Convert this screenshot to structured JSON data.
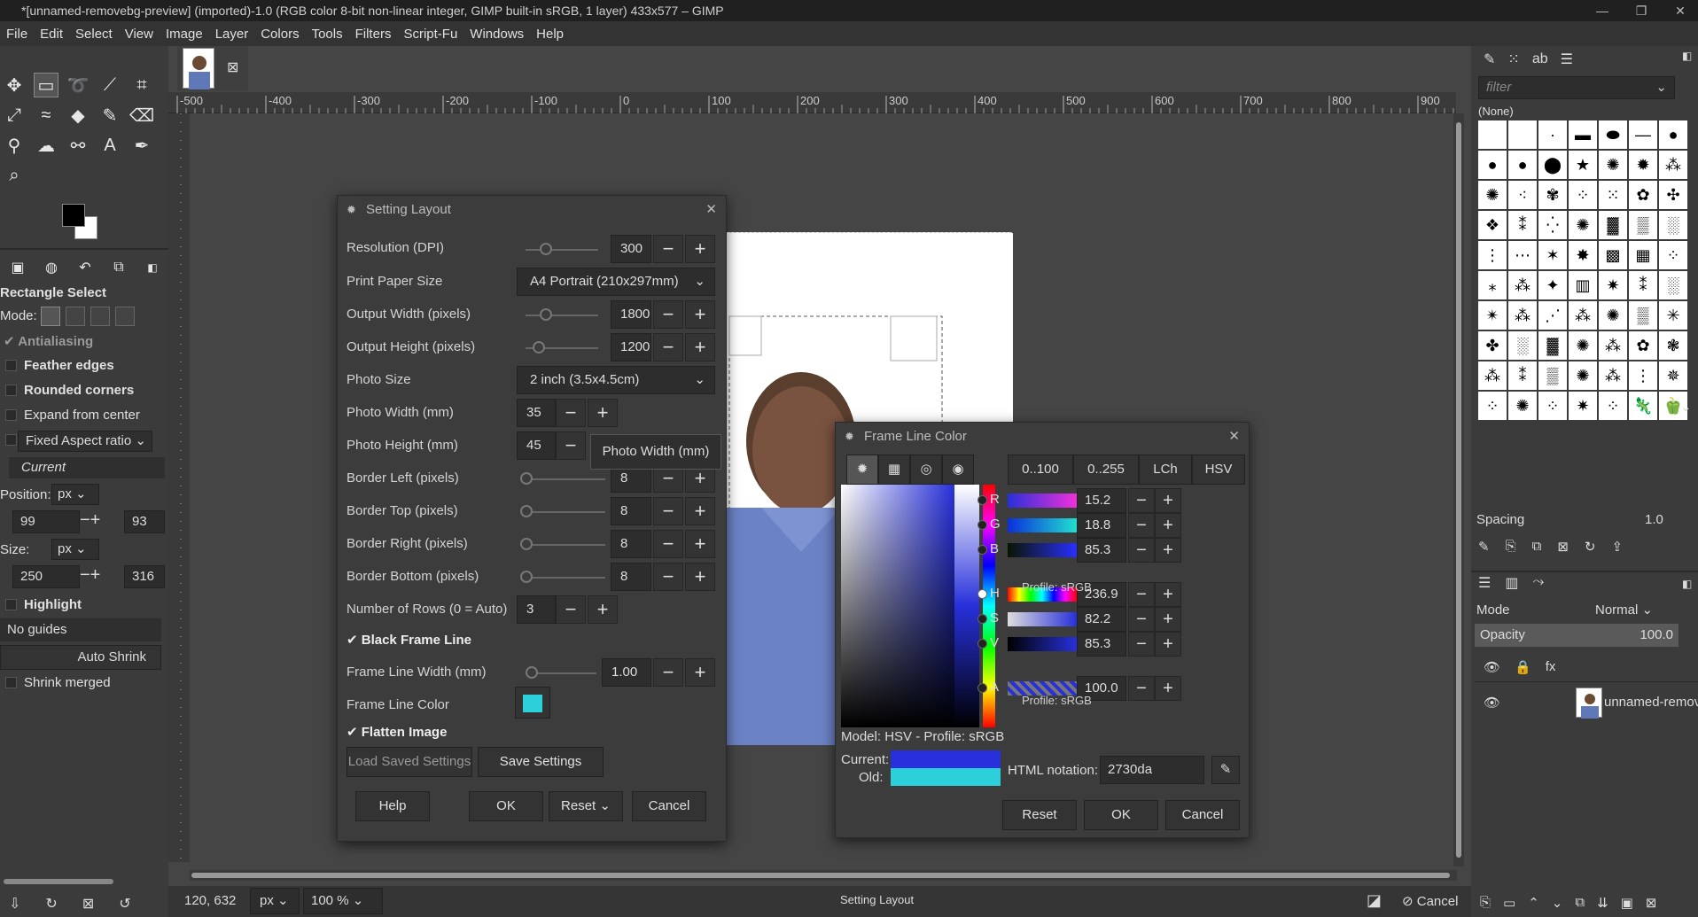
{
  "window": {
    "title": "*[unnamed-removebg-preview] (imported)-1.0 (RGB color 8-bit non-linear integer, GIMP built-in sRGB, 1 layer) 433x577 – GIMP",
    "min": "—",
    "max": "❐",
    "close": "✕"
  },
  "menu": [
    "File",
    "Edit",
    "Select",
    "View",
    "Image",
    "Layer",
    "Colors",
    "Tools",
    "Filters",
    "Script-Fu",
    "Windows",
    "Help"
  ],
  "tool_options": {
    "title": "Rectangle Select",
    "mode_label": "Mode:",
    "antialiasing": "Antialiasing",
    "feather": "Feather edges",
    "rounded": "Rounded corners",
    "expand": "Expand from center",
    "fixed": "Fixed Aspect ratio",
    "current": "Current",
    "position_label": "Position:",
    "pos_unit": "px",
    "pos_x": "99",
    "pos_y": "93",
    "size_label": "Size:",
    "size_unit": "px",
    "size_w": "250",
    "size_h": "316",
    "highlight": "Highlight",
    "guides": "No guides",
    "auto_shrink": "Auto Shrink",
    "shrink_merged": "Shrink merged"
  },
  "ruler": {
    "h_labels": [
      "-500",
      "-400",
      "-300",
      "-200",
      "-100",
      "0",
      "100",
      "200",
      "300",
      "400",
      "500",
      "600",
      "700",
      "800",
      "900"
    ]
  },
  "layout_dialog": {
    "title": "Setting Layout",
    "rows": [
      {
        "label": "Resolution (DPI)",
        "value": "300"
      },
      {
        "label": "Print Paper Size",
        "value": "A4 Portrait (210x297mm)"
      },
      {
        "label": "Output Width (pixels)",
        "value": "1800"
      },
      {
        "label": "Output Height (pixels)",
        "value": "1200"
      },
      {
        "label": "Photo Size",
        "value": "2 inch (3.5x4.5cm)"
      },
      {
        "label": "Photo Width (mm)",
        "value": "35"
      },
      {
        "label": "Photo Height (mm)",
        "value": "45"
      },
      {
        "label": "Border Left (pixels)",
        "value": "8"
      },
      {
        "label": "Border Top (pixels)",
        "value": "8"
      },
      {
        "label": "Border Right (pixels)",
        "value": "8"
      },
      {
        "label": "Border Bottom (pixels)",
        "value": "8"
      },
      {
        "label": "Number of Rows (0 = Auto)",
        "value": "3"
      }
    ],
    "black_frame": "Black Frame Line",
    "frame_width_label": "Frame Line Width (mm)",
    "frame_width": "1.00",
    "frame_color_label": "Frame Line Color",
    "frame_color": "#2bd0da",
    "flatten": "Flatten Image",
    "load": "Load Saved Settings",
    "save": "Save Settings",
    "help": "Help",
    "ok": "OK",
    "reset": "Reset",
    "cancel": "Cancel",
    "tooltip": "Photo Width (mm)"
  },
  "color_dialog": {
    "title": "Frame Line Color",
    "tabs": [
      "0..100",
      "0..255",
      "LCh",
      "HSV"
    ],
    "channels": [
      {
        "name": "R",
        "value": "15.2"
      },
      {
        "name": "G",
        "value": "18.8"
      },
      {
        "name": "B",
        "value": "85.3"
      },
      {
        "name": "H",
        "value": "236.9"
      },
      {
        "name": "S",
        "value": "82.2"
      },
      {
        "name": "V",
        "value": "85.3"
      },
      {
        "name": "A",
        "value": "100.0"
      }
    ],
    "profile": "Profile: sRGB",
    "model": "Model: HSV - Profile: sRGB",
    "current": "Current:",
    "old": "Old:",
    "html_label": "HTML notation:",
    "html_value": "2730da",
    "reset": "Reset",
    "ok": "OK",
    "cancel": "Cancel",
    "current_color": "#2730da",
    "old_color": "#2bd0da"
  },
  "brushes": {
    "filter": "filter",
    "none": "(None)",
    "spacing_label": "Spacing",
    "spacing_value": "1.0"
  },
  "layers": {
    "mode_label": "Mode",
    "mode_value": "Normal",
    "opacity_label": "Opacity",
    "opacity_value": "100.0",
    "layer_name": "unnamed-remov"
  },
  "status": {
    "coords": "120, 632",
    "unit": "px",
    "zoom": "100 %",
    "message": "Setting Layout",
    "cancel": "Cancel"
  }
}
